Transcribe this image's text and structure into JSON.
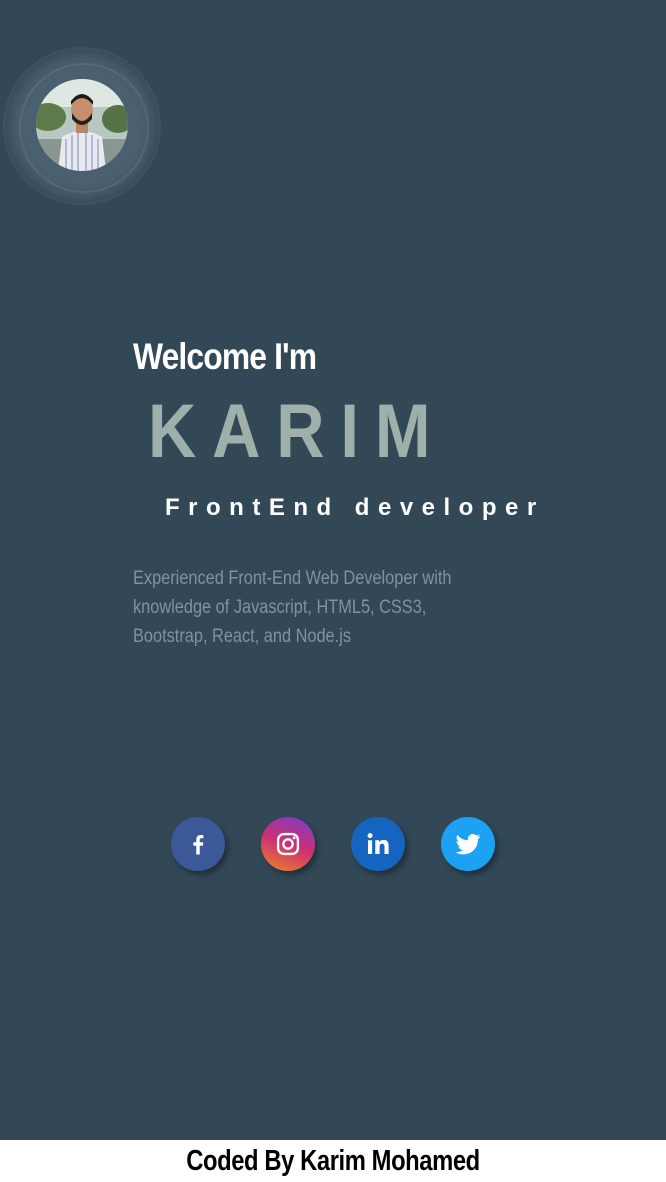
{
  "hero": {
    "welcome": "Welcome I'm",
    "name": "KARIM",
    "role": "FrontEnd developer",
    "bio": "Experienced Front-End Web Developer with knowledge of Javascript, HTML5, CSS3, Bootstrap, React, and Node.js"
  },
  "avatar": {
    "icon": "profile-photo"
  },
  "socials": [
    {
      "name": "facebook",
      "icon": "facebook-icon",
      "color": "#3b5998"
    },
    {
      "name": "instagram",
      "icon": "instagram-icon",
      "color": "#cd2f74"
    },
    {
      "name": "linkedin",
      "icon": "linkedin-icon",
      "color": "#1565c0"
    },
    {
      "name": "twitter",
      "icon": "twitter-icon",
      "color": "#1da1f2"
    }
  ],
  "footer": {
    "credit": "Coded By Karim Mohamed"
  },
  "colors": {
    "background": "#324857",
    "name_accent": "#9fb0ab",
    "bio_text": "#7d939d"
  }
}
